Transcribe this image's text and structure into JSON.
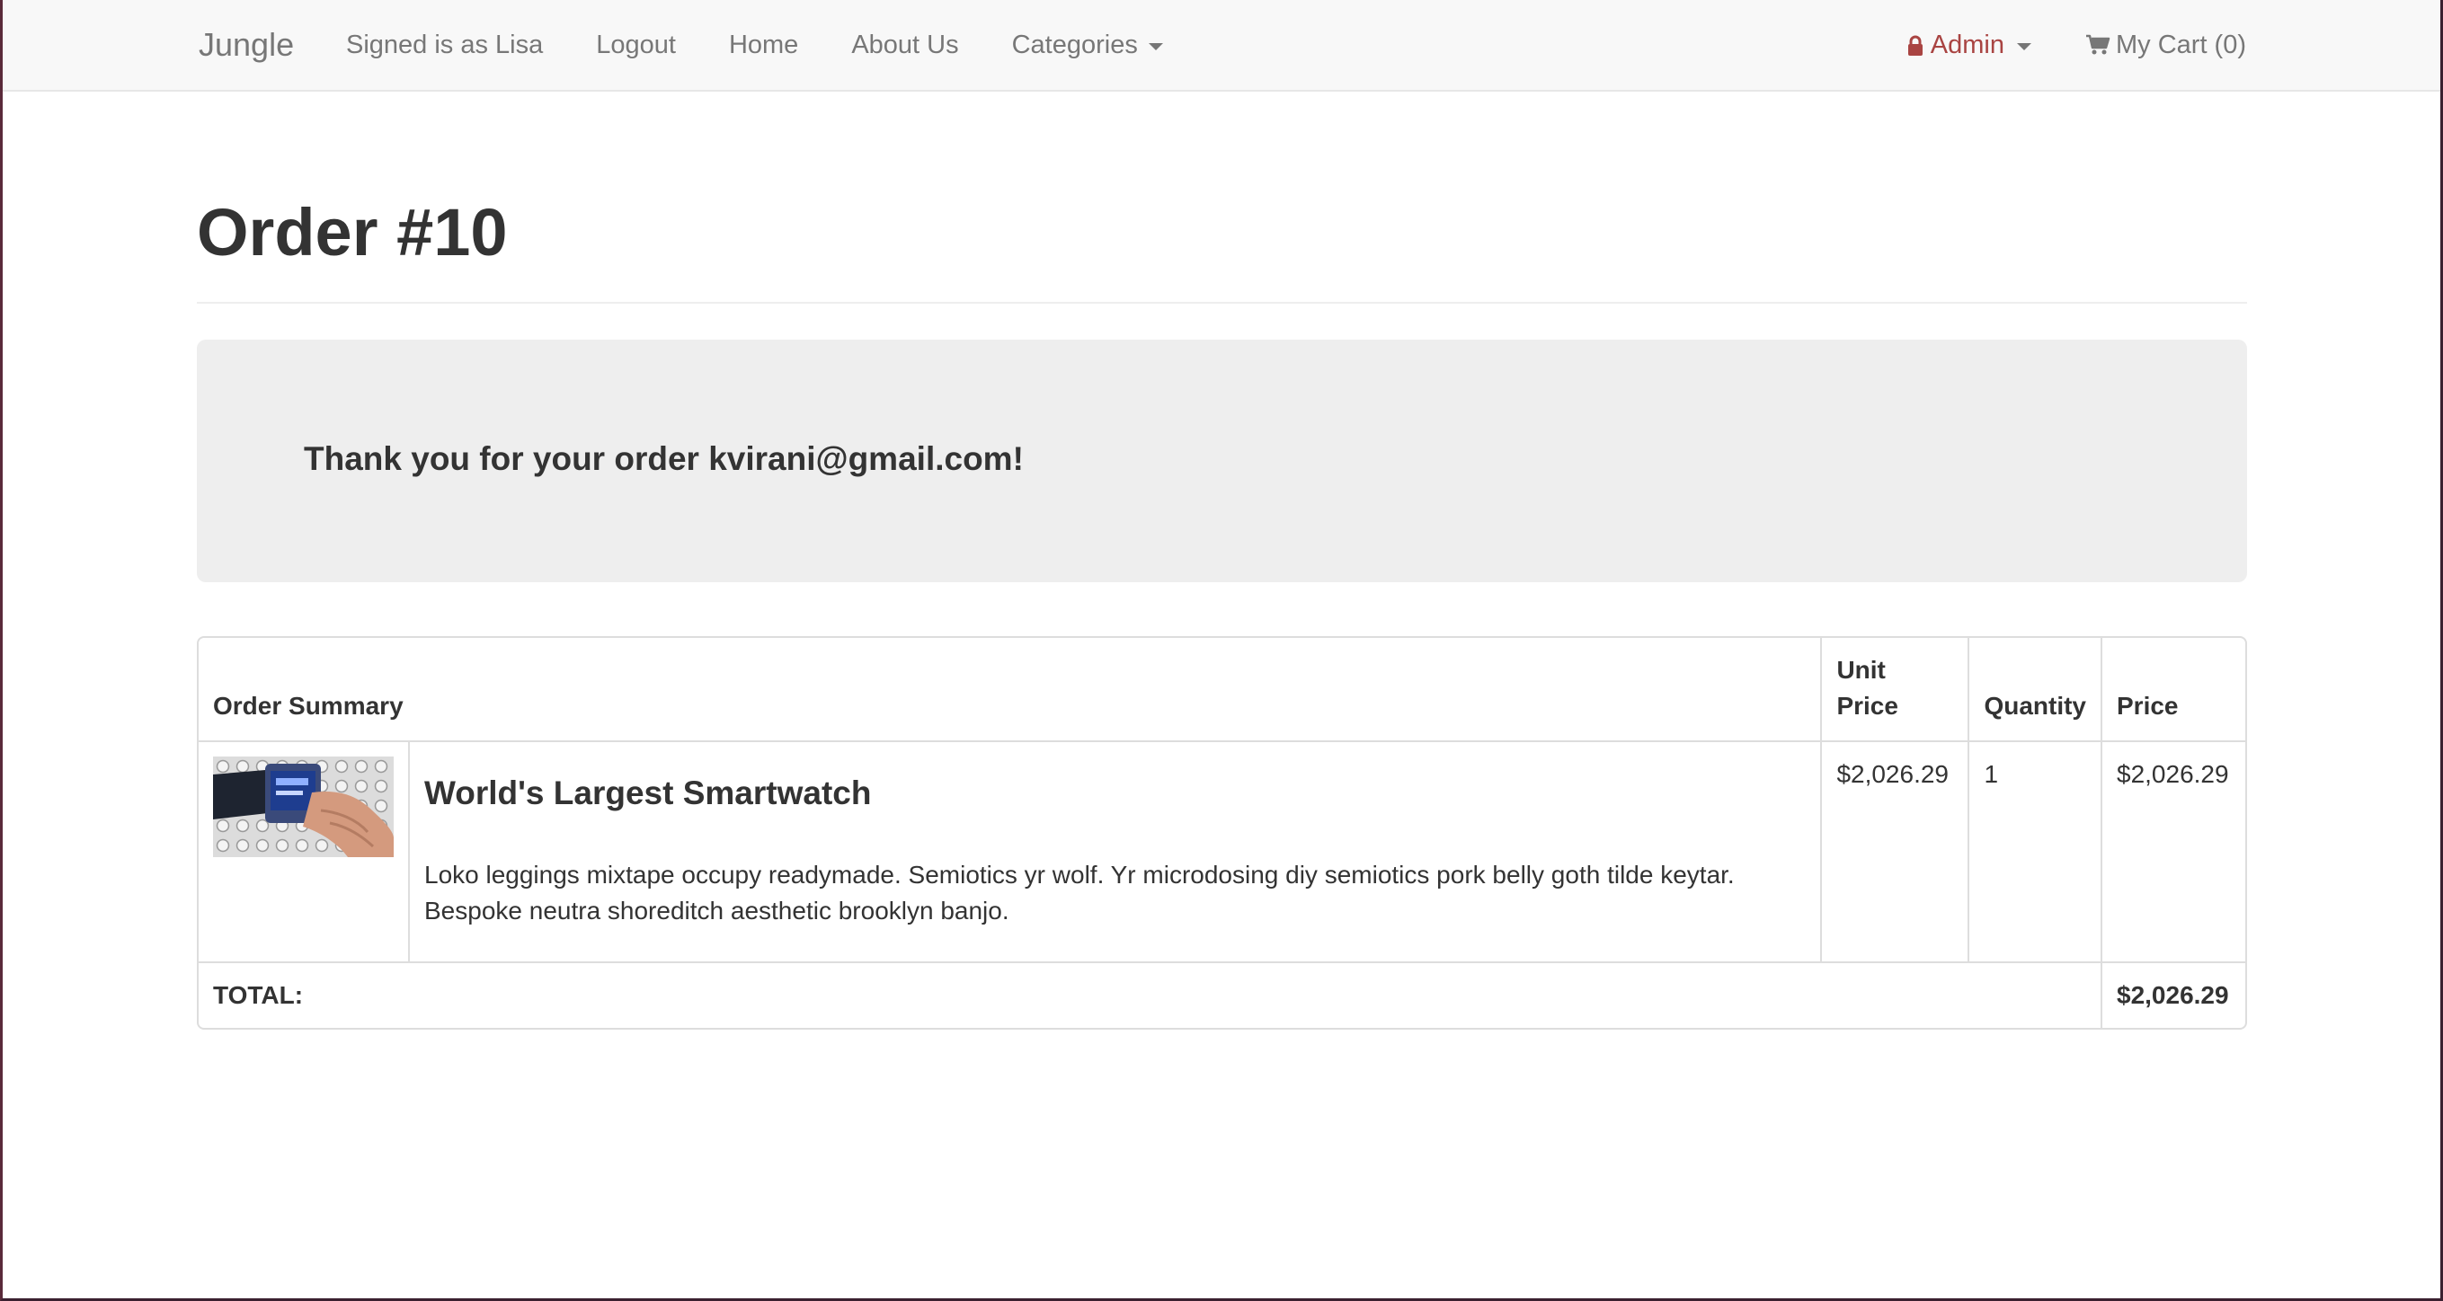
{
  "navbar": {
    "brand": "Jungle",
    "signed_in": "Signed is as Lisa",
    "logout": "Logout",
    "home": "Home",
    "about": "About Us",
    "categories": "Categories",
    "admin": "Admin",
    "cart": "My Cart (0)"
  },
  "page": {
    "title": "Order #10"
  },
  "jumbotron": {
    "message": "Thank you for your order kvirani@gmail.com!"
  },
  "order_table": {
    "headers": {
      "summary": "Order Summary",
      "unit_price": "Unit Price",
      "quantity": "Quantity",
      "price": "Price"
    },
    "items": [
      {
        "name": "World's Largest Smartwatch",
        "description": "Loko leggings mixtape occupy readymade. Semiotics yr wolf. Yr microdosing diy semiotics pork belly goth tilde keytar. Bespoke neutra shoreditch aesthetic brooklyn banjo.",
        "unit_price": "$2,026.29",
        "quantity": "1",
        "price": "$2,026.29"
      }
    ],
    "total_label": "TOTAL:",
    "total_value": "$2,026.29"
  },
  "colors": {
    "navbar_bg": "#f8f8f8",
    "admin_red": "#a94442",
    "jumbotron_bg": "#eeeeee",
    "text": "#333333",
    "nav_text": "#777777"
  }
}
